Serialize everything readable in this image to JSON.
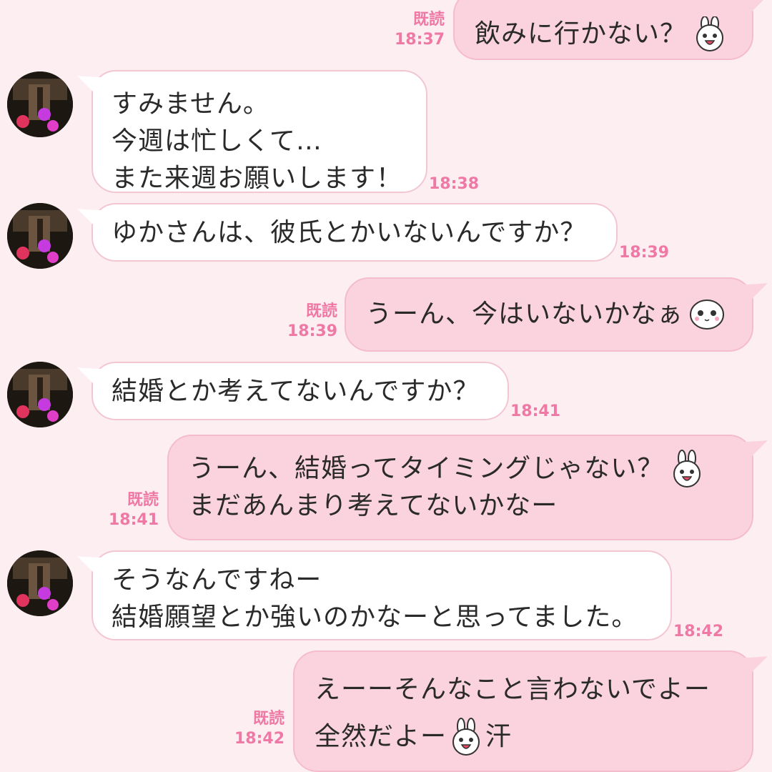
{
  "colors": {
    "background": "#fdeef2",
    "incoming_bubble": "#ffffff",
    "outgoing_bubble": "#fbd3de",
    "bubble_border": "#f3c6d4",
    "timestamp": "#f078a4"
  },
  "messages": [
    {
      "dir": "out",
      "read": "既読",
      "time": "18:37",
      "lines": [
        "飲みに行かない？"
      ],
      "sticker": "bunny-face-sticker"
    },
    {
      "dir": "in",
      "time": "18:38",
      "lines": [
        "すみません。",
        "今週は忙しくて…",
        "また来週お願いします！"
      ]
    },
    {
      "dir": "in",
      "time": "18:39",
      "lines": [
        "ゆかさんは、彼氏とかいないんですか？"
      ]
    },
    {
      "dir": "out",
      "read": "既読",
      "time": "18:39",
      "lines": [
        "うーん、今はいないかなぁ"
      ],
      "sticker": "cute-face-sticker"
    },
    {
      "dir": "in",
      "time": "18:41",
      "lines": [
        "結婚とか考えてないんですか？"
      ]
    },
    {
      "dir": "out",
      "read": "既読",
      "time": "18:41",
      "lines": [
        "うーん、結婚ってタイミングじゃない？",
        "まだあんまり考えてないかなー"
      ],
      "sticker": "bunny-face-sticker"
    },
    {
      "dir": "in",
      "time": "18:42",
      "lines": [
        "そうなんですねー",
        "結婚願望とか強いのかなーと思ってました。"
      ]
    },
    {
      "dir": "out",
      "read": "既読",
      "time": "18:42",
      "lines": [
        "えーーそんなこと言わないでよー",
        "全然だよー",
        "汗"
      ],
      "sticker": "bunny-face-sticker"
    }
  ]
}
